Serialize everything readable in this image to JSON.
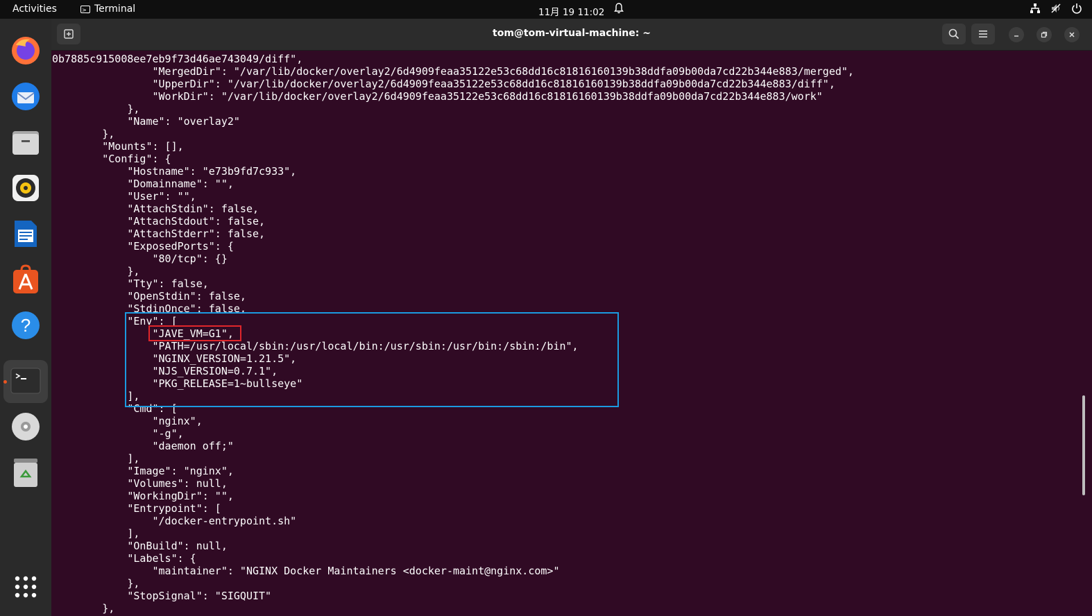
{
  "topbar": {
    "activities": "Activities",
    "app_name": "Terminal",
    "clock": "11月 19  11:02"
  },
  "dock": {
    "apps": [
      "firefox-icon",
      "thunderbird-icon",
      "files-icon",
      "rhythmbox-icon",
      "writer-icon",
      "software-icon",
      "help-icon",
      "terminal-icon",
      "disc-icon",
      "trash-icon",
      "app-grid-icon"
    ]
  },
  "window": {
    "title": "tom@tom-virtual-machine: ~"
  },
  "colors": {
    "terminal_bg": "#300a24",
    "highlight_blue": "#1b9ae0",
    "highlight_red": "#e0262b",
    "accent": "#e95420"
  },
  "terminal": {
    "lines": [
      "0b7885c915008ee7eb9f73d46ae743049/diff\",",
      "                \"MergedDir\": \"/var/lib/docker/overlay2/6d4909feaa35122e53c68dd16c81816160139b38ddfa09b00da7cd22b344e883/merged\",",
      "                \"UpperDir\": \"/var/lib/docker/overlay2/6d4909feaa35122e53c68dd16c81816160139b38ddfa09b00da7cd22b344e883/diff\",",
      "                \"WorkDir\": \"/var/lib/docker/overlay2/6d4909feaa35122e53c68dd16c81816160139b38ddfa09b00da7cd22b344e883/work\"",
      "            },",
      "            \"Name\": \"overlay2\"",
      "        },",
      "        \"Mounts\": [],",
      "        \"Config\": {",
      "            \"Hostname\": \"e73b9fd7c933\",",
      "            \"Domainname\": \"\",",
      "            \"User\": \"\",",
      "            \"AttachStdin\": false,",
      "            \"AttachStdout\": false,",
      "            \"AttachStderr\": false,",
      "            \"ExposedPorts\": {",
      "                \"80/tcp\": {}",
      "            },",
      "            \"Tty\": false,",
      "            \"OpenStdin\": false,",
      "            \"StdinOnce\": false,",
      "            \"Env\": [",
      "                \"JAVE_VM=G1\",",
      "                \"PATH=/usr/local/sbin:/usr/local/bin:/usr/sbin:/usr/bin:/sbin:/bin\",",
      "                \"NGINX_VERSION=1.21.5\",",
      "                \"NJS_VERSION=0.7.1\",",
      "                \"PKG_RELEASE=1~bullseye\"",
      "            ],",
      "            \"Cmd\": [",
      "                \"nginx\",",
      "                \"-g\",",
      "                \"daemon off;\"",
      "            ],",
      "            \"Image\": \"nginx\",",
      "            \"Volumes\": null,",
      "            \"WorkingDir\": \"\",",
      "            \"Entrypoint\": [",
      "                \"/docker-entrypoint.sh\"",
      "            ],",
      "            \"OnBuild\": null,",
      "            \"Labels\": {",
      "                \"maintainer\": \"NGINX Docker Maintainers <docker-maint@nginx.com>\"",
      "            },",
      "            \"StopSignal\": \"SIGQUIT\"",
      "        },"
    ]
  }
}
